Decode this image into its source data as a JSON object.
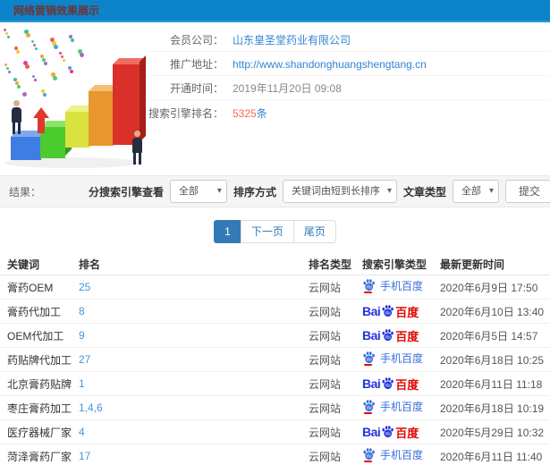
{
  "header": {
    "title": "网络营销效果展示"
  },
  "info": {
    "rows": [
      {
        "label": "会员公司：",
        "value": "山东皇圣堂药业有限公司"
      },
      {
        "label": "推广地址：",
        "value": "http://www.shandonghuangshengtang.cn"
      },
      {
        "label": "开通时间：",
        "value": "2019年11月20日 09:08"
      },
      {
        "label": "搜索引擎排名：",
        "value": "5325",
        "suffix": "条"
      }
    ]
  },
  "graphic": {
    "bar_colors": [
      {
        "front": "#3f7de2",
        "top": "#7fa9ef",
        "side": "#2b5ab2"
      },
      {
        "front": "#4ccb2f",
        "top": "#8de36e",
        "side": "#359a1d"
      },
      {
        "front": "#d9e23e",
        "top": "#ecf283",
        "side": "#a9b224"
      },
      {
        "front": "#e8962e",
        "top": "#f3bf76",
        "side": "#b66f1a"
      },
      {
        "front": "#d93029",
        "top": "#ee6e5f",
        "side": "#a61e19"
      }
    ],
    "confetti_colors": [
      "#e74c3c",
      "#f39c12",
      "#f1c40f",
      "#2ecc71",
      "#3498db",
      "#9b59b6",
      "#e91e8c",
      "#1abc9c"
    ],
    "suit_color": "#262d41",
    "skin_color": "#d8b08c",
    "arrow_color": "#e0382c"
  },
  "filters": {
    "result_label": "结果：",
    "engine_label": "分搜索引擎查看",
    "engine_value": "全部",
    "sort_label": "排序方式",
    "sort_value": "关键词由短到长排序",
    "article_label": "文章类型",
    "article_value": "全部",
    "submit_label": "提交"
  },
  "pagination": {
    "current": "1",
    "next": "下一页",
    "last": "尾页"
  },
  "table": {
    "headers": [
      "关键词",
      "排名",
      "排名类型",
      "搜索引擎类型",
      "最新更新时间"
    ],
    "engine_types": {
      "mobile": "手机百度",
      "pc_prefix": "Bai",
      "pc": "百度"
    },
    "rows": [
      {
        "keyword": "膏药OEM",
        "rank": "25",
        "rank_type": "云网站",
        "engine": "mobile",
        "time": "2020年6月9日 17:50"
      },
      {
        "keyword": "膏药代加工",
        "rank": "8",
        "rank_type": "云网站",
        "engine": "pc",
        "time": "2020年6月10日 13:40"
      },
      {
        "keyword": "OEM代加工",
        "rank": "9",
        "rank_type": "云网站",
        "engine": "pc",
        "time": "2020年6月5日 14:57"
      },
      {
        "keyword": "药贴牌代加工",
        "rank": "27",
        "rank_type": "云网站",
        "engine": "mobile",
        "time": "2020年6月18日 10:25"
      },
      {
        "keyword": "北京膏药贴牌",
        "rank": "1",
        "rank_type": "云网站",
        "engine": "pc",
        "time": "2020年6月11日 11:18"
      },
      {
        "keyword": "枣庄膏药加工",
        "rank": "1,4,6",
        "rank_type": "云网站",
        "engine": "mobile",
        "time": "2020年6月18日 10:19"
      },
      {
        "keyword": "医疗器械厂家",
        "rank": "4",
        "rank_type": "云网站",
        "engine": "pc",
        "time": "2020年5月29日 10:32"
      },
      {
        "keyword": "菏泽膏药厂家",
        "rank": "17",
        "rank_type": "云网站",
        "engine": "mobile",
        "time": "2020年6月11日 11:40"
      }
    ]
  },
  "colors": {
    "header_bg": "#0d83c9",
    "header_text": "#6f3333",
    "link_blue": "#3185d3",
    "rank_blue": "#4a94d9",
    "highlight_orange": "#f9694a",
    "pager_active": "#337ab7",
    "baidu_blue": "#2534dd",
    "baidu_red": "#e10601",
    "mobile_baidu_blue": "#3a6fdb"
  }
}
